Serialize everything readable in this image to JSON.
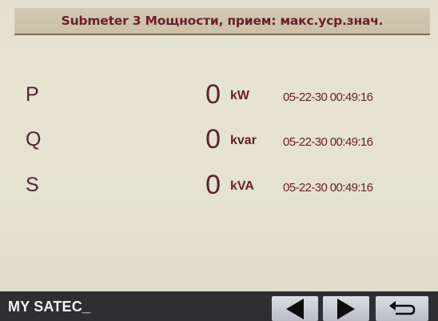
{
  "header": {
    "title": "Submeter 3 Мощности, прием: макс.уср.знач."
  },
  "rows": [
    {
      "label": "P",
      "value": "0",
      "unit": "kW",
      "timestamp": "05-22-30 00:49:16"
    },
    {
      "label": "Q",
      "value": "0",
      "unit": "kvar",
      "timestamp": "05-22-30 00:49:16"
    },
    {
      "label": "S",
      "value": "0",
      "unit": "kVA",
      "timestamp": "05-22-30 00:49:16"
    }
  ],
  "footer": {
    "status": "MY SATEC_",
    "buttons": {
      "prev_icon": "left-triangle-icon",
      "next_icon": "right-triangle-icon",
      "back_icon": "return-arrow-icon"
    }
  },
  "colors": {
    "screen_bg": "#e4e1d0",
    "title_bg": "#cec4ac",
    "text_accent": "#6a1f29",
    "footer_bg": "#2f2f33",
    "button_bg": "#c9cbd3"
  }
}
